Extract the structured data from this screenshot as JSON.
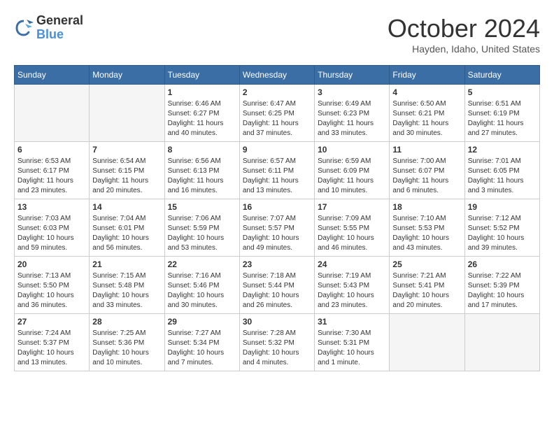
{
  "header": {
    "logo_line1": "General",
    "logo_line2": "Blue",
    "month_title": "October 2024",
    "location": "Hayden, Idaho, United States"
  },
  "days_of_week": [
    "Sunday",
    "Monday",
    "Tuesday",
    "Wednesday",
    "Thursday",
    "Friday",
    "Saturday"
  ],
  "weeks": [
    [
      {
        "day": "",
        "sunrise": "",
        "sunset": "",
        "daylight": "",
        "empty": true
      },
      {
        "day": "",
        "sunrise": "",
        "sunset": "",
        "daylight": "",
        "empty": true
      },
      {
        "day": "1",
        "sunrise": "Sunrise: 6:46 AM",
        "sunset": "Sunset: 6:27 PM",
        "daylight": "Daylight: 11 hours and 40 minutes."
      },
      {
        "day": "2",
        "sunrise": "Sunrise: 6:47 AM",
        "sunset": "Sunset: 6:25 PM",
        "daylight": "Daylight: 11 hours and 37 minutes."
      },
      {
        "day": "3",
        "sunrise": "Sunrise: 6:49 AM",
        "sunset": "Sunset: 6:23 PM",
        "daylight": "Daylight: 11 hours and 33 minutes."
      },
      {
        "day": "4",
        "sunrise": "Sunrise: 6:50 AM",
        "sunset": "Sunset: 6:21 PM",
        "daylight": "Daylight: 11 hours and 30 minutes."
      },
      {
        "day": "5",
        "sunrise": "Sunrise: 6:51 AM",
        "sunset": "Sunset: 6:19 PM",
        "daylight": "Daylight: 11 hours and 27 minutes."
      }
    ],
    [
      {
        "day": "6",
        "sunrise": "Sunrise: 6:53 AM",
        "sunset": "Sunset: 6:17 PM",
        "daylight": "Daylight: 11 hours and 23 minutes."
      },
      {
        "day": "7",
        "sunrise": "Sunrise: 6:54 AM",
        "sunset": "Sunset: 6:15 PM",
        "daylight": "Daylight: 11 hours and 20 minutes."
      },
      {
        "day": "8",
        "sunrise": "Sunrise: 6:56 AM",
        "sunset": "Sunset: 6:13 PM",
        "daylight": "Daylight: 11 hours and 16 minutes."
      },
      {
        "day": "9",
        "sunrise": "Sunrise: 6:57 AM",
        "sunset": "Sunset: 6:11 PM",
        "daylight": "Daylight: 11 hours and 13 minutes."
      },
      {
        "day": "10",
        "sunrise": "Sunrise: 6:59 AM",
        "sunset": "Sunset: 6:09 PM",
        "daylight": "Daylight: 11 hours and 10 minutes."
      },
      {
        "day": "11",
        "sunrise": "Sunrise: 7:00 AM",
        "sunset": "Sunset: 6:07 PM",
        "daylight": "Daylight: 11 hours and 6 minutes."
      },
      {
        "day": "12",
        "sunrise": "Sunrise: 7:01 AM",
        "sunset": "Sunset: 6:05 PM",
        "daylight": "Daylight: 11 hours and 3 minutes."
      }
    ],
    [
      {
        "day": "13",
        "sunrise": "Sunrise: 7:03 AM",
        "sunset": "Sunset: 6:03 PM",
        "daylight": "Daylight: 10 hours and 59 minutes."
      },
      {
        "day": "14",
        "sunrise": "Sunrise: 7:04 AM",
        "sunset": "Sunset: 6:01 PM",
        "daylight": "Daylight: 10 hours and 56 minutes."
      },
      {
        "day": "15",
        "sunrise": "Sunrise: 7:06 AM",
        "sunset": "Sunset: 5:59 PM",
        "daylight": "Daylight: 10 hours and 53 minutes."
      },
      {
        "day": "16",
        "sunrise": "Sunrise: 7:07 AM",
        "sunset": "Sunset: 5:57 PM",
        "daylight": "Daylight: 10 hours and 49 minutes."
      },
      {
        "day": "17",
        "sunrise": "Sunrise: 7:09 AM",
        "sunset": "Sunset: 5:55 PM",
        "daylight": "Daylight: 10 hours and 46 minutes."
      },
      {
        "day": "18",
        "sunrise": "Sunrise: 7:10 AM",
        "sunset": "Sunset: 5:53 PM",
        "daylight": "Daylight: 10 hours and 43 minutes."
      },
      {
        "day": "19",
        "sunrise": "Sunrise: 7:12 AM",
        "sunset": "Sunset: 5:52 PM",
        "daylight": "Daylight: 10 hours and 39 minutes."
      }
    ],
    [
      {
        "day": "20",
        "sunrise": "Sunrise: 7:13 AM",
        "sunset": "Sunset: 5:50 PM",
        "daylight": "Daylight: 10 hours and 36 minutes."
      },
      {
        "day": "21",
        "sunrise": "Sunrise: 7:15 AM",
        "sunset": "Sunset: 5:48 PM",
        "daylight": "Daylight: 10 hours and 33 minutes."
      },
      {
        "day": "22",
        "sunrise": "Sunrise: 7:16 AM",
        "sunset": "Sunset: 5:46 PM",
        "daylight": "Daylight: 10 hours and 30 minutes."
      },
      {
        "day": "23",
        "sunrise": "Sunrise: 7:18 AM",
        "sunset": "Sunset: 5:44 PM",
        "daylight": "Daylight: 10 hours and 26 minutes."
      },
      {
        "day": "24",
        "sunrise": "Sunrise: 7:19 AM",
        "sunset": "Sunset: 5:43 PM",
        "daylight": "Daylight: 10 hours and 23 minutes."
      },
      {
        "day": "25",
        "sunrise": "Sunrise: 7:21 AM",
        "sunset": "Sunset: 5:41 PM",
        "daylight": "Daylight: 10 hours and 20 minutes."
      },
      {
        "day": "26",
        "sunrise": "Sunrise: 7:22 AM",
        "sunset": "Sunset: 5:39 PM",
        "daylight": "Daylight: 10 hours and 17 minutes."
      }
    ],
    [
      {
        "day": "27",
        "sunrise": "Sunrise: 7:24 AM",
        "sunset": "Sunset: 5:37 PM",
        "daylight": "Daylight: 10 hours and 13 minutes."
      },
      {
        "day": "28",
        "sunrise": "Sunrise: 7:25 AM",
        "sunset": "Sunset: 5:36 PM",
        "daylight": "Daylight: 10 hours and 10 minutes."
      },
      {
        "day": "29",
        "sunrise": "Sunrise: 7:27 AM",
        "sunset": "Sunset: 5:34 PM",
        "daylight": "Daylight: 10 hours and 7 minutes."
      },
      {
        "day": "30",
        "sunrise": "Sunrise: 7:28 AM",
        "sunset": "Sunset: 5:32 PM",
        "daylight": "Daylight: 10 hours and 4 minutes."
      },
      {
        "day": "31",
        "sunrise": "Sunrise: 7:30 AM",
        "sunset": "Sunset: 5:31 PM",
        "daylight": "Daylight: 10 hours and 1 minute."
      },
      {
        "day": "",
        "sunrise": "",
        "sunset": "",
        "daylight": "",
        "empty": true
      },
      {
        "day": "",
        "sunrise": "",
        "sunset": "",
        "daylight": "",
        "empty": true
      }
    ]
  ]
}
